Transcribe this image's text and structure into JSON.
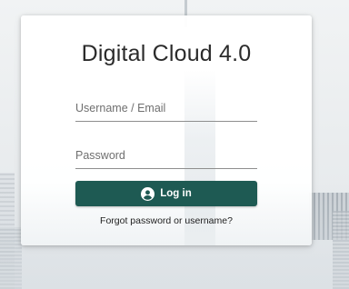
{
  "login": {
    "title": "Digital Cloud 4.0",
    "username_placeholder": "Username / Email",
    "username_value": "",
    "password_placeholder": "Password",
    "password_value": "",
    "login_button_label": "Log in",
    "login_button_icon": "user-circle-icon",
    "forgot_link": "Forgot password or username?"
  },
  "colors": {
    "primary_button": "#1e5a53",
    "button_text": "#ffffff",
    "title_text": "#2b2b2b"
  }
}
